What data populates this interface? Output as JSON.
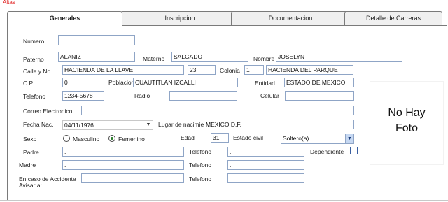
{
  "group_legend": "Altas",
  "tabs": [
    {
      "label": "Generales",
      "active": true
    },
    {
      "label": "Inscripcion",
      "active": false
    },
    {
      "label": "Documentacion",
      "active": false
    },
    {
      "label": "Detalle de Carreras",
      "active": false
    }
  ],
  "form": {
    "numero": {
      "label": "Numero",
      "value": ""
    },
    "paterno": {
      "label": "Paterno",
      "value": "ALANIZ"
    },
    "materno": {
      "label": "Materno",
      "value": "SALGADO"
    },
    "nombre": {
      "label": "Nombre",
      "value": "JOSELYN"
    },
    "calle": {
      "label": "Calle y No.",
      "value": "HACIENDA DE LA LLAVE",
      "numero": "23"
    },
    "colonia": {
      "label": "Colonia",
      "number": "1",
      "value": "HACIENDA DEL PARQUE"
    },
    "cp": {
      "label": "C.P.",
      "value": "0"
    },
    "poblacion": {
      "label": "Poblacion",
      "value": "CUAUTITLAN IZCALLI"
    },
    "entidad": {
      "label": "Entidad",
      "value": "ESTADO DE MEXICO"
    },
    "telefono": {
      "label": "Telefono",
      "value": "1234-5678"
    },
    "radio": {
      "label": "Radio",
      "value": ""
    },
    "celular": {
      "label": "Celular",
      "value": ""
    },
    "correo": {
      "label": "Correo Electronico",
      "value": ""
    },
    "fecha_nac": {
      "label": "Fecha Nac.",
      "value": "04/11/1976"
    },
    "lugar_nac": {
      "label": "Lugar de nacimiento",
      "value": "MEXICO D.F."
    },
    "sexo": {
      "label": "Sexo",
      "options": [
        "Masculino",
        "Femenino"
      ],
      "selected": "Femenino"
    },
    "edad": {
      "label": "Edad",
      "value": "31"
    },
    "estado_civil": {
      "label": "Estado civil",
      "value": "Soltero(a)"
    },
    "padre": {
      "label": "Padre",
      "value": ".",
      "telefono_label": "Telefono",
      "telefono": "."
    },
    "dependiente": {
      "label": "Dependiente",
      "checked": false
    },
    "madre": {
      "label": "Madre",
      "value": ".",
      "telefono_label": "Telefono",
      "telefono": "."
    },
    "accidente": {
      "label_line1": "En caso de Accidente",
      "label_line2": "Avisar a:",
      "value": ".",
      "telefono_label": "Telefono",
      "telefono": "."
    }
  },
  "photo": {
    "line1": "No Hay",
    "line2": "Foto"
  },
  "colors": {
    "legend": "#e02020",
    "input_border": "#8fa5c6",
    "select_button": "#c6d8f2"
  }
}
